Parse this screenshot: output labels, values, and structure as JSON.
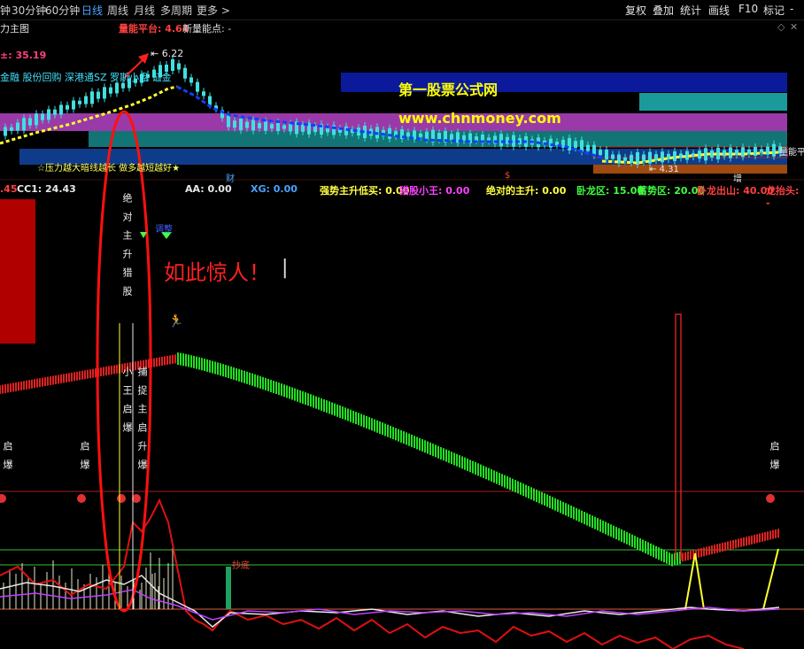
{
  "toolbar": {
    "left_items": [
      {
        "label": "钟",
        "active": false
      },
      {
        "label": "30分钟",
        "active": false
      },
      {
        "label": "60分钟",
        "active": false
      },
      {
        "label": "日线",
        "active": true
      },
      {
        "label": "周线",
        "active": false
      },
      {
        "label": "月线",
        "active": false
      },
      {
        "label": "多周期",
        "active": false
      },
      {
        "label": "更多 >",
        "active": false
      }
    ],
    "right_items": [
      "复权",
      "叠加",
      "统计",
      "画线",
      "F10",
      "标记",
      "-"
    ]
  },
  "header": {
    "chart_title": "力主图",
    "energy_label": "量能平台: 4.64",
    "new_energy_label": "新量能点: -"
  },
  "main_chart": {
    "price_label_left": "±: 35.19",
    "high_price": "6.22",
    "low_price": "4.31",
    "info_line": "金融 股份回购 深港通SZ 罗斯小盘 证金",
    "pressure_note": "☆压力越大暗线越长 做多越短越好★",
    "watermark_title": "第一股票公式网",
    "watermark_url": "www.chnmoney.com",
    "right_edge_label": "量能平",
    "markers": {
      "cai": "财",
      "dollar": "$",
      "zeng": "增"
    }
  },
  "indicators": [
    {
      "label": ".45",
      "color": "#ff4040"
    },
    {
      "label": "CC1: 24.43",
      "color": "#e8e8e8"
    },
    {
      "label": "AA: 0.00",
      "color": "#e8e8e8"
    },
    {
      "label": "XG: 0.00",
      "color": "#4aa3ff"
    },
    {
      "label": "强势主升低买: 0.00",
      "color": "#ffff40"
    },
    {
      "label": "猎股小王: 0.00",
      "color": "#ff40ff"
    },
    {
      "label": "绝对的主升: 0.00",
      "color": "#ffff40"
    },
    {
      "label": "卧龙区: 15.00",
      "color": "#40ff40"
    },
    {
      "label": "蓄势区: 20.00",
      "color": "#40ff40"
    },
    {
      "label": "卧龙出山: 40.00",
      "color": "#ff4040"
    },
    {
      "label": "龙抬头: -",
      "color": "#ff4040"
    }
  ],
  "lower_chart": {
    "annotation": "如此惊人！",
    "flag_label": "调整",
    "vertical_text_1": "绝对主升猎股",
    "vertical_text_2": "小王启爆",
    "vertical_text_3": "捕捉主启升爆",
    "qibao_left": "启爆",
    "qibao_mid": "启爆",
    "qibao_right": "启爆",
    "chaodi_label": "抄底"
  },
  "colors": {
    "up_candle": "#ff4040",
    "down_candle": "#40e0e0",
    "ribbon_red": "#e02020",
    "ribbon_green": "#20e020",
    "annotation": "#ff2020",
    "watermark_bg": "#0a1a9a",
    "watermark_text": "#ffff00"
  }
}
